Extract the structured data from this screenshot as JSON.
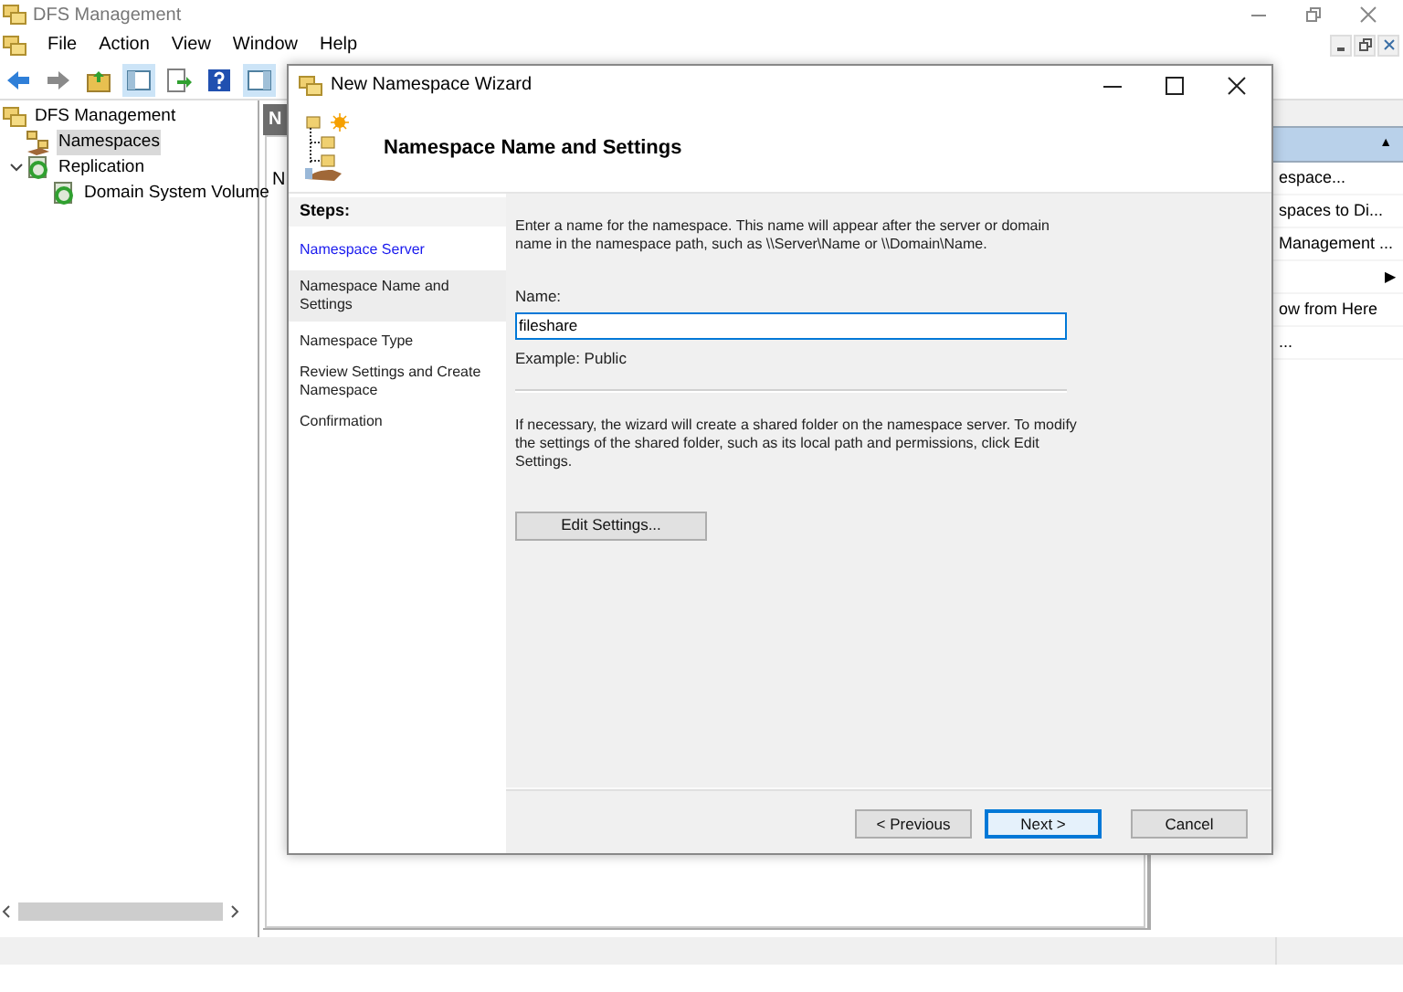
{
  "window": {
    "title": "DFS Management"
  },
  "menu": [
    "File",
    "Action",
    "View",
    "Window",
    "Help"
  ],
  "tree": [
    {
      "label": "DFS Management",
      "selected": false,
      "children": [
        {
          "label": "Namespaces",
          "selected": true
        },
        {
          "label": "Replication",
          "selected": false,
          "expanded": true,
          "children": [
            {
              "label": "Domain System Volume",
              "selected": false
            }
          ]
        }
      ]
    }
  ],
  "center": {
    "header": "N",
    "text": "N"
  },
  "actions": {
    "header_glyph": "▲",
    "items": [
      {
        "label": "espace...",
        "kind": "text"
      },
      {
        "label": "spaces to Di...",
        "kind": "text"
      },
      {
        "label": "Management ...",
        "kind": "text"
      },
      {
        "label": "▶",
        "kind": "submenu"
      },
      {
        "label": "ow from Here",
        "kind": "text"
      },
      {
        "label": "...",
        "kind": "text"
      }
    ]
  },
  "wizard": {
    "title": "New Namespace Wizard",
    "heading": "Namespace Name and Settings",
    "steps_label": "Steps:",
    "steps": [
      {
        "label": "Namespace Server",
        "done": true,
        "selected": false
      },
      {
        "label": "Namespace Name and Settings",
        "done": false,
        "selected": true
      },
      {
        "label": "Namespace Type",
        "done": false,
        "selected": false
      },
      {
        "label": "Review Settings and Create Namespace",
        "done": false,
        "selected": false
      },
      {
        "label": "Confirmation",
        "done": false,
        "selected": false
      }
    ],
    "intro": "Enter a name for the namespace. This name will appear after the server or domain name in the namespace path, such as \\\\Server\\Name or \\\\Domain\\Name.",
    "name_label": "Name:",
    "name_value": "fileshare",
    "example": "Example: Public",
    "note": "If necessary, the wizard will create a shared folder on the namespace server. To modify the settings of the shared folder, such as its local path and permissions, click Edit Settings.",
    "edit_button": "Edit Settings...",
    "buttons": [
      {
        "label": "< Previous",
        "default": false
      },
      {
        "label": "Next >",
        "default": true
      },
      {
        "label": "Cancel",
        "default": false
      }
    ]
  }
}
